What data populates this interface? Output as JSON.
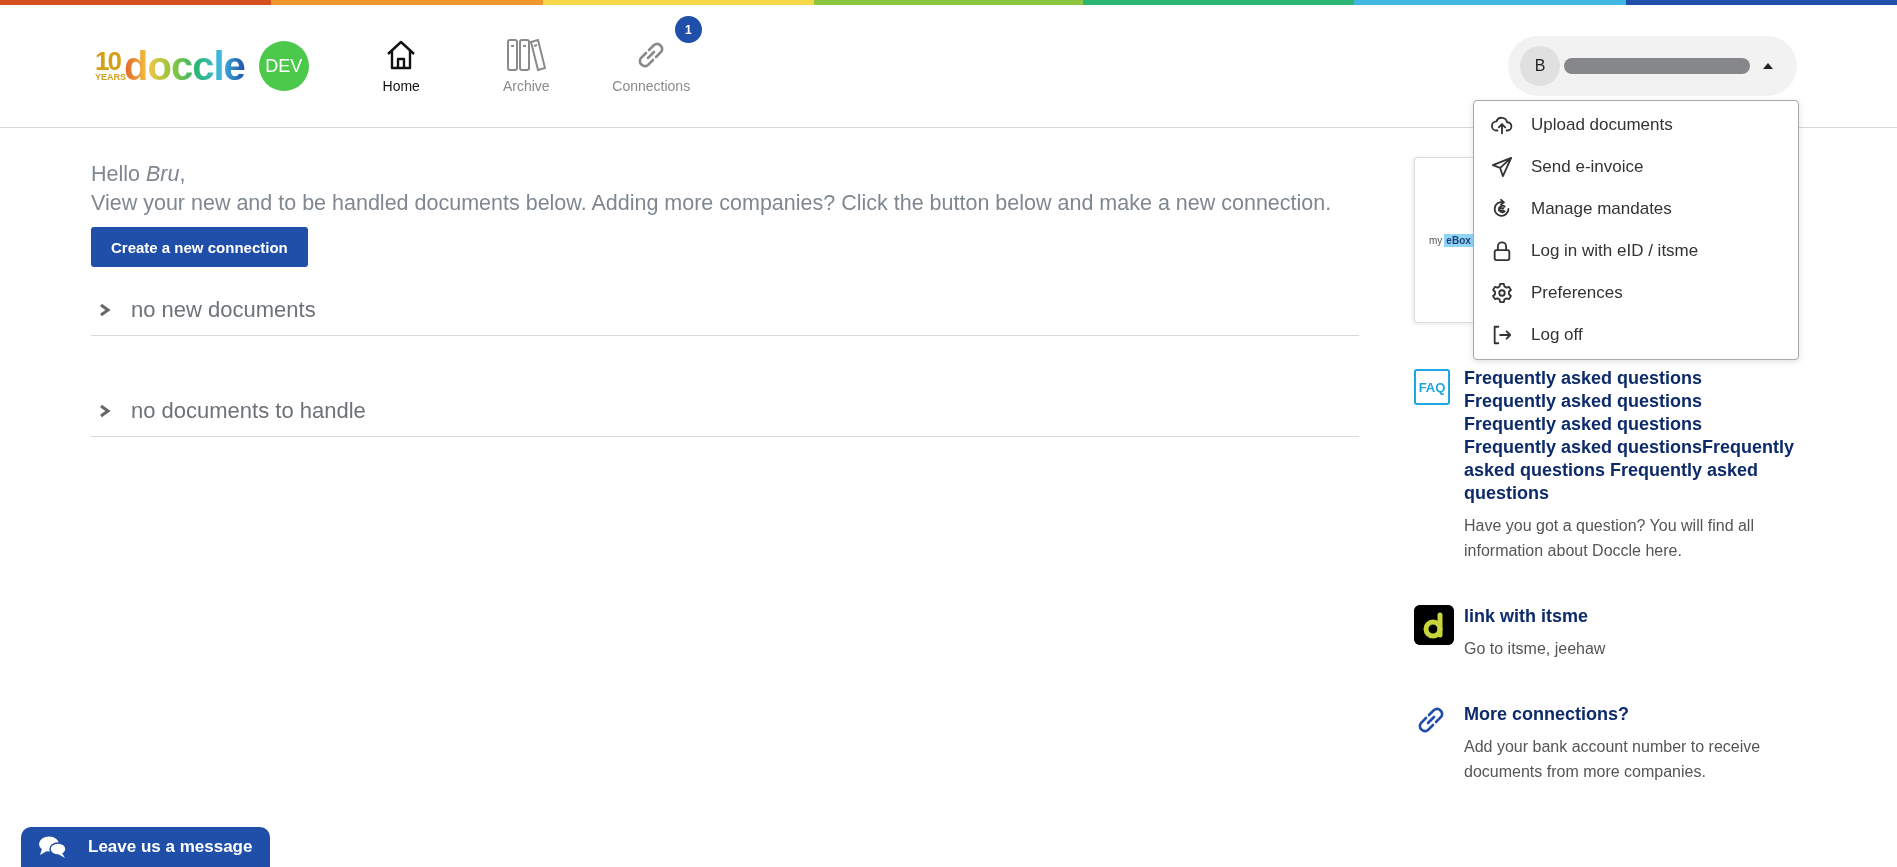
{
  "logo": {
    "emblem_number": "10",
    "emblem_label": "YEARS",
    "wordmark": "doccle",
    "env_badge": "DEV"
  },
  "nav": [
    {
      "label": "Home",
      "kind": "home",
      "selected": true
    },
    {
      "label": "Archive",
      "kind": "archive",
      "selected": false
    },
    {
      "label": "Connections",
      "kind": "link",
      "selected": false,
      "badge": "1"
    }
  ],
  "user": {
    "initial": "B",
    "menu_open": true
  },
  "menu": [
    {
      "label": "Upload documents",
      "kind": "upload"
    },
    {
      "label": "Send e-invoice",
      "kind": "send"
    },
    {
      "label": "Manage mandates",
      "kind": "euro"
    },
    {
      "label": "Log in with eID / itsme",
      "kind": "lock"
    },
    {
      "label": "Preferences",
      "kind": "gear"
    },
    {
      "label": "Log off",
      "kind": "logout"
    }
  ],
  "greeting": {
    "hello": "Hello *Bru*,",
    "intro": "View your new and to be handled documents below. Adding more companies? Click the button below and make a new connection."
  },
  "create_button": "Create a new connection",
  "sections": [
    {
      "title": "no new documents",
      "expanded": false
    },
    {
      "title": "no documents to handle",
      "expanded": false
    }
  ],
  "sidebar": {
    "promo": {
      "logo_prefix": "my",
      "logo_main": "eBox"
    },
    "items": [
      {
        "kind": "faq",
        "icon_label": "FAQ",
        "title": "Frequently asked questions\nFrequently asked questions\nFrequently asked questions\nFrequently asked questionsFrequently asked questions Frequently asked questions",
        "description": "Have you got a question? You will find all information about Doccle here."
      },
      {
        "kind": "app",
        "title": "link with itsme",
        "description": "Go to itsme, jeehaw"
      },
      {
        "kind": "link",
        "title": "More connections?",
        "description": "Add your bank account number to receive documents from more companies."
      }
    ]
  },
  "chat_button": "Leave us a message"
}
